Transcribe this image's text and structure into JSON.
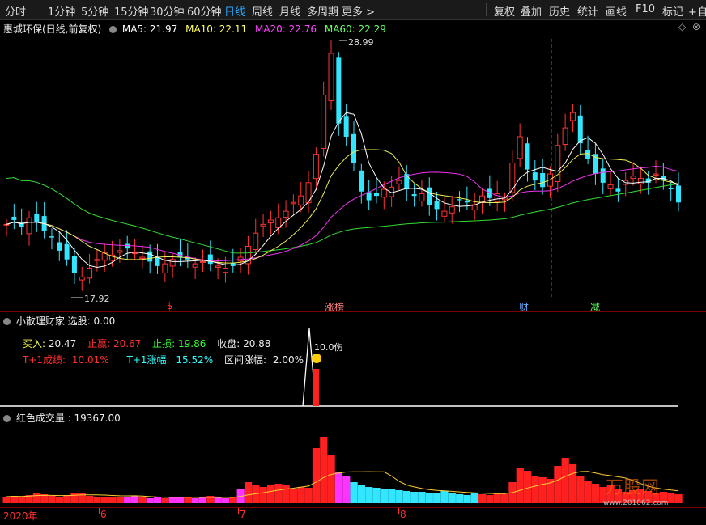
{
  "toolbar": {
    "left": [
      "分时",
      "1分钟",
      "5分钟",
      "15分钟",
      "30分钟",
      "60分钟",
      "日线",
      "周线",
      "月线",
      "多周期",
      "更多 >"
    ],
    "active_index": 6,
    "right": [
      "复权",
      "叠加",
      "历史",
      "统计",
      "画线",
      "F10",
      "标记",
      "+自选"
    ]
  },
  "main": {
    "title": "惠城环保(日线,前复权)",
    "ma5": "MA5: 21.97",
    "ma10": "MA10: 22.11",
    "ma20": "MA20: 22.76",
    "ma60": "MA60: 22.29",
    "high_label": "28.99",
    "low_label": "17.92",
    "markers": [
      {
        "text": "$",
        "color": "#ff3030"
      },
      {
        "text": "涨榜",
        "color": "#ff8080"
      },
      {
        "text": "财",
        "color": "#66aaff"
      },
      {
        "text": "减",
        "color": "#66ff66"
      }
    ]
  },
  "indicator": {
    "title": "小散理财家  选股: 0.00",
    "buy_label": "买入:",
    "buy_value": "20.47",
    "stop_gain_label": "止赢:",
    "stop_gain_value": "20.67",
    "stop_loss_label": "止损:",
    "stop_loss_value": "19.86",
    "close_label": "收盘:",
    "close_value": "20.88",
    "t1_result_label": "T+1成绩:",
    "t1_result_value": "10.01%",
    "t1_rise_label": "T+1涨幅:",
    "t1_rise_value": "15.52%",
    "range_label": "区间涨幅:",
    "range_value": "2.00%",
    "annot": "10.0伤"
  },
  "volume": {
    "title": "红色成交量 : 19367.00",
    "watermark": "www.201062.com"
  },
  "xaxis": {
    "labels": [
      "2020年",
      "6",
      "7",
      "8"
    ]
  },
  "colors": {
    "up": "#ff3333",
    "down": "#33e6ff",
    "ma5": "#ffffff",
    "ma10": "#ffff66",
    "ma20": "#ff44ff",
    "ma60": "#66ff66"
  }
}
